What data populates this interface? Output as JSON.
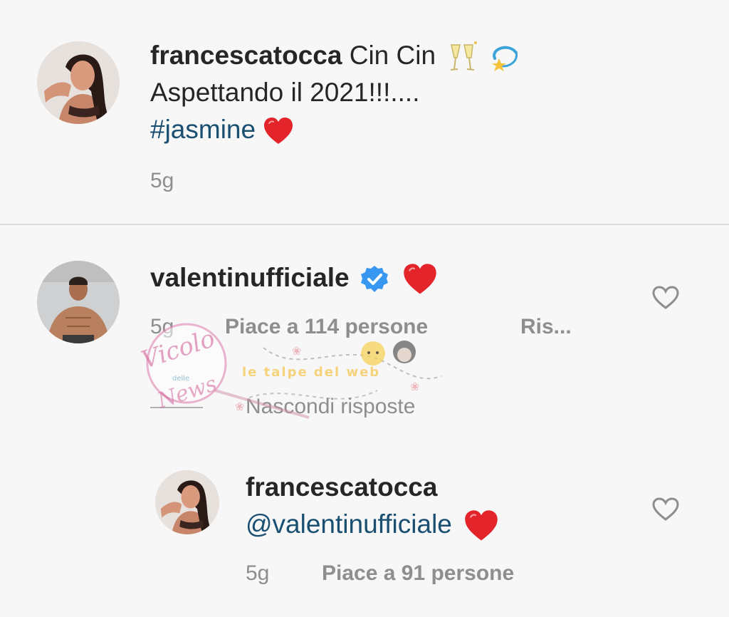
{
  "comment1": {
    "username": "francescatocca",
    "line1": "Cin Cin",
    "line2": "Aspettando il 2021!!!....",
    "hashtag": "#jasmine",
    "time": "5g",
    "emojis": [
      "clinking-glasses",
      "dizzy-star",
      "red-heart"
    ]
  },
  "comment2": {
    "username": "valentinufficiale",
    "verified": true,
    "time": "5g",
    "likes": "Piace a 114 persone",
    "reply": "Ris...",
    "hide_replies": "Nascondi risposte",
    "emojis": [
      "red-heart"
    ]
  },
  "reply1": {
    "username": "francescatocca",
    "mention": "@valentinufficiale",
    "time": "5g",
    "likes": "Piace a 91 persone",
    "emojis": [
      "red-heart"
    ]
  },
  "watermark": {
    "logo_text": "Vicolo delle News",
    "banner_text": "le talpe del web"
  },
  "colors": {
    "username": "#262626",
    "meta": "#8e8e8e",
    "link": "#1a4f72",
    "verified": "#3897f0",
    "heart": "#e3252b"
  }
}
